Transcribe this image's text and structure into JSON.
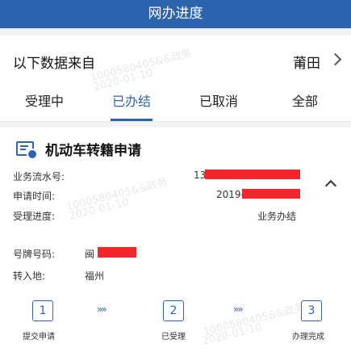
{
  "header": {
    "title": "网办进度"
  },
  "source": {
    "label": "以下数据来自",
    "city": "莆田"
  },
  "tabs": [
    {
      "label": "受理中"
    },
    {
      "label": "已办结"
    },
    {
      "label": "已取消"
    },
    {
      "label": "全部"
    }
  ],
  "card": {
    "title": "机动车转籍申请",
    "serial": {
      "label": "业务流水号:",
      "value": "13"
    },
    "apply_time": {
      "label": "申请时间:",
      "value": "2019-"
    },
    "progress": {
      "label": "受理进度:",
      "value": "业务办结"
    },
    "plate": {
      "label": "号牌号码:",
      "value": "闽"
    },
    "transfer": {
      "label": "转入地:",
      "value": "福州"
    }
  },
  "steps": [
    {
      "num": "1",
      "label": "提交申请"
    },
    {
      "num": "2",
      "label": "已受理"
    },
    {
      "num": "3",
      "label": "办理完成"
    }
  ],
  "step_arrow": "»»",
  "watermark": {
    "line1": "1000580405&&政务",
    "line2": "2020-01-10"
  },
  "colors": {
    "primary": "#2e64ae",
    "redaction": "#f2262b"
  }
}
